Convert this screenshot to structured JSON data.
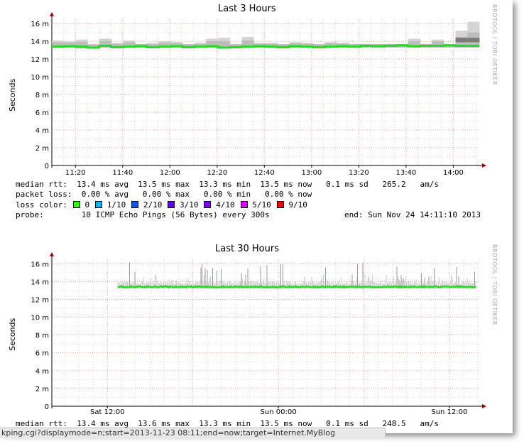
{
  "chart_data": [
    {
      "type": "area",
      "title": "Last 3 Hours",
      "ylabel": "Seconds",
      "watermark": "RRDTOOL / TOBI OETIKER",
      "ylim": [
        0,
        16.5
      ],
      "yticks": [
        0,
        2,
        4,
        6,
        8,
        10,
        12,
        14,
        16
      ],
      "yticklabels": [
        "0",
        "2 m",
        "4 m",
        "6 m",
        "8 m",
        "10 m",
        "12 m",
        "14 m",
        "16 m"
      ],
      "xticklabels": [
        "11:20",
        "11:40",
        "12:00",
        "12:20",
        "12:40",
        "13:00",
        "13:20",
        "13:40",
        "14:00"
      ],
      "bin_start_label": "11:10",
      "bin_minutes": 5,
      "median": [
        13.4,
        13.45,
        13.4,
        13.3,
        13.5,
        13.35,
        13.4,
        13.45,
        13.35,
        13.4,
        13.45,
        13.35,
        13.4,
        13.45,
        13.3,
        13.35,
        13.4,
        13.45,
        13.4,
        13.35,
        13.45,
        13.4,
        13.35,
        13.4,
        13.45,
        13.4,
        13.5,
        13.45,
        13.5,
        13.55,
        13.45,
        13.5,
        13.5,
        13.55,
        13.5,
        13.5
      ],
      "smoke_max": [
        14.1,
        14.0,
        14.2,
        13.7,
        14.3,
        13.8,
        14.1,
        13.7,
        13.8,
        14.0,
        13.9,
        13.7,
        13.8,
        14.3,
        14.4,
        13.7,
        14.5,
        13.8,
        13.8,
        13.7,
        13.9,
        13.8,
        13.7,
        13.9,
        13.8,
        13.7,
        13.7,
        13.7,
        13.7,
        13.7,
        14.3,
        13.7,
        14.2,
        13.7,
        15.2,
        16.2
      ],
      "smoke_min": [
        13.3,
        13.3,
        13.2,
        13.2,
        13.3,
        13.2,
        13.3,
        13.3,
        13.2,
        13.3,
        13.3,
        13.2,
        13.3,
        13.3,
        13.2,
        13.2,
        13.3,
        13.3,
        13.3,
        13.2,
        13.3,
        13.3,
        13.2,
        13.3,
        13.3,
        13.3,
        13.3,
        13.3,
        13.3,
        13.3,
        13.3,
        13.3,
        13.3,
        13.3,
        13.3,
        13.3
      ]
    },
    {
      "type": "area",
      "title": "Last 30 Hours",
      "ylabel": "Seconds",
      "watermark": "RRDTOOL / TOBI OETIKER",
      "ylim": [
        0,
        16.5
      ],
      "yticks": [
        0,
        2,
        4,
        6,
        8,
        10,
        12,
        14,
        16
      ],
      "yticklabels": [
        "0",
        "2 m",
        "4 m",
        "6 m",
        "8 m",
        "10 m",
        "12 m",
        "14 m",
        "16 m"
      ],
      "xticklabels": [
        "Sat 12:00",
        "Sun 00:00",
        "Sun 12:00"
      ],
      "median_approx_ms": 13.4,
      "spike_max_ms": 16.2
    }
  ],
  "legend3h": {
    "l1": "median rtt:  13.4 ms avg  13.5 ms max  13.3 ms min  13.5 ms now   0.1 ms sd   265.2   am/s",
    "l2": "packet loss:  0.00 % avg   0.00 % max   0.00 % min   0.00 % now",
    "l3": "loss color:",
    "l4_probe": "probe:        10 ICMP Echo Pings (56 Bytes) every 300s",
    "l4_end": "end: Sun Nov 24 14:11:10 2013",
    "loss_items": [
      {
        "label": "0",
        "color": "#26ff00"
      },
      {
        "label": "1/10",
        "color": "#00b8ff"
      },
      {
        "label": "2/10",
        "color": "#0059ff"
      },
      {
        "label": "3/10",
        "color": "#5e00ff"
      },
      {
        "label": "4/10",
        "color": "#7e00ff"
      },
      {
        "label": "5/10",
        "color": "#dd00ff"
      },
      {
        "label": "9/10",
        "color": "#ff0000"
      }
    ]
  },
  "legend30h": {
    "l1": "median rtt:  13.4 ms avg  13.6 ms max  13.3 ms min  13.5 ms now   0.1 ms sd   248.5   am/s"
  },
  "statusbar": {
    "url": "kping.cgi?displaymode=n;start=2013-11-23 08:11;end=now;target=Internet.MyBlog"
  }
}
